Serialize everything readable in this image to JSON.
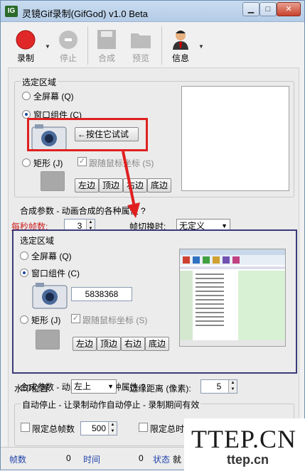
{
  "window": {
    "title": "灵镜Gif录制(GifGod) v1.0 Beta",
    "icon_label": "IG"
  },
  "toolbar": {
    "record": "录制",
    "stop": "停止",
    "combine": "合成",
    "preview": "预览",
    "info": "信息"
  },
  "region": {
    "title": "选定区域",
    "fullscreen": "全屏幕 (Q)",
    "window_widget": "窗口组件 (C)",
    "hold_test": "←按住它试试",
    "rect": "矩形 (J)",
    "follow_mouse": "跟随鼠标坐标 (S)",
    "left": "左边",
    "top": "顶边",
    "right": "右边",
    "bottom": "底边",
    "handle_value": "5838368"
  },
  "combine": {
    "title": "合成参数 - 动画合成的各种属性 ?",
    "fps_label": "每秒帧数:",
    "fps_value": "3",
    "switch_label": "帧切换时:",
    "switch_value": "无定义",
    "watermark_label": "水印位置:",
    "watermark_value": "左上",
    "margin_label": "边缘距离 (像素):",
    "margin_value": "5"
  },
  "autostop": {
    "title": "自动停止 - 让录制动作自动停止 - 录制期间有效",
    "limit_frames": "限定总帧数",
    "frames_value": "500",
    "limit_time": "限定总时"
  },
  "status": {
    "frames": "帧数",
    "frames_value": "0",
    "time": "时间",
    "time_value": "0",
    "state": "状态",
    "state_value": "就"
  },
  "watermark": {
    "big": "TTEP.CN",
    "small": "ttep.cn"
  },
  "colors": {
    "accent_red": "#e02020",
    "navy": "#3a3a7a",
    "link_blue": "#2244aa"
  }
}
